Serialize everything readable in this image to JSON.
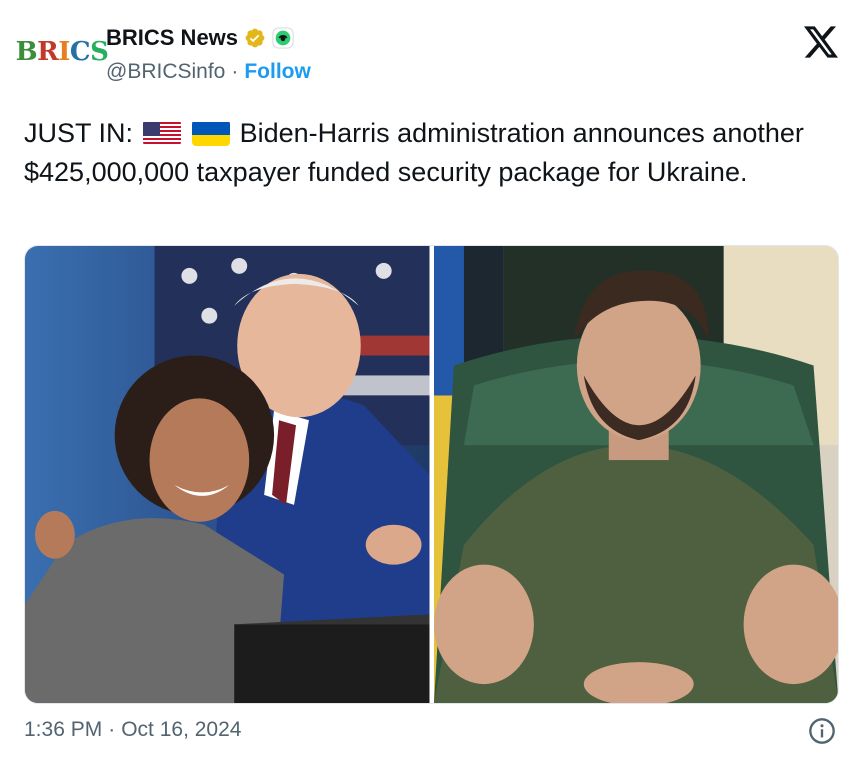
{
  "author": {
    "display_name": "BRICS News",
    "handle": "@BRICSinfo",
    "separator": "·",
    "follow_label": "Follow",
    "avatar_text": "BRICS",
    "verified_icon": "verified-badge-icon",
    "affiliate_icon": "affiliate-badge-icon"
  },
  "header": {
    "logo_icon": "x-logo-icon"
  },
  "tweet": {
    "prefix": "JUST IN:",
    "flags": [
      "us-flag-icon",
      "ukraine-flag-icon"
    ],
    "body": "Biden-Harris administration announces another $425,000,000 taxpayer funded security package for Ukraine."
  },
  "media": {
    "images": [
      {
        "name": "harris-biden-hug-photo"
      },
      {
        "name": "zelensky-portrait-photo"
      }
    ]
  },
  "footer": {
    "time": "1:36 PM",
    "separator": "·",
    "date": "Oct 16, 2024",
    "info_icon": "info-icon"
  },
  "colors": {
    "text": "#0f1419",
    "muted": "#536471",
    "link": "#1d9bf0",
    "verified_gold": "#e2b719"
  }
}
